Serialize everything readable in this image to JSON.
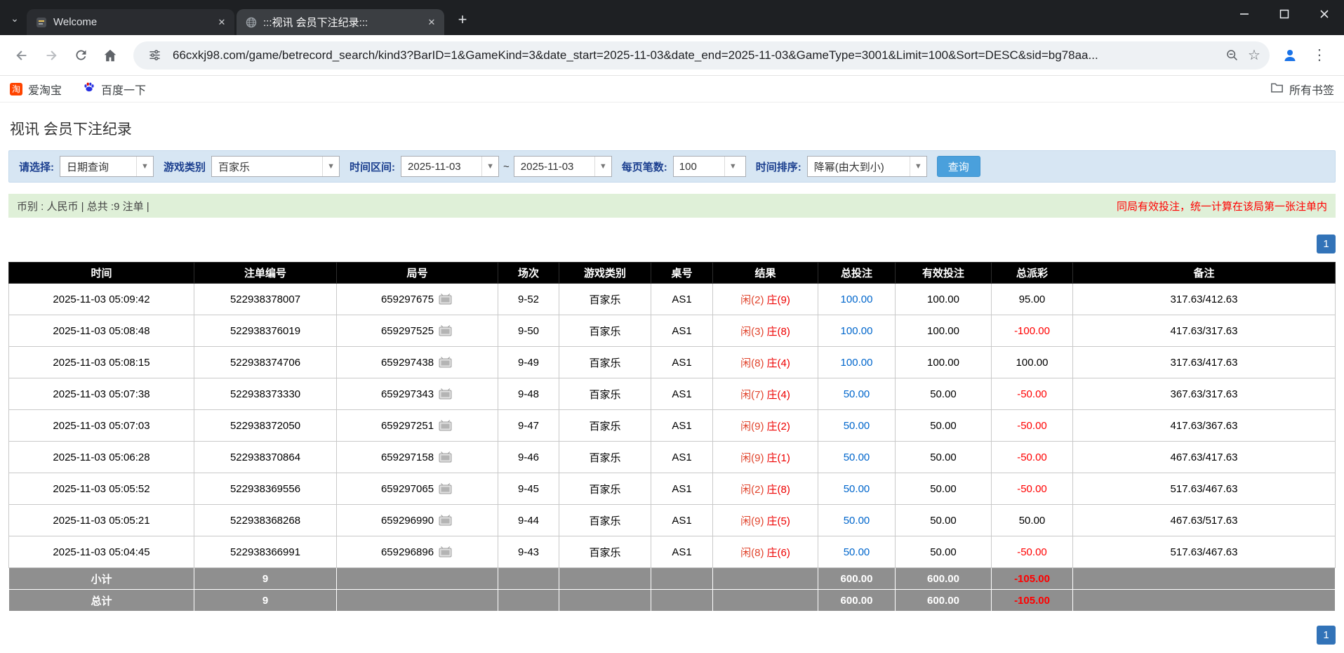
{
  "colors": {
    "accent_blue": "#3273b8",
    "link_blue": "#0066cc",
    "negative_red": "#ff0000",
    "player_color": "#e0442c",
    "banker_color": "#ee0000",
    "filter_bar_bg": "#d7e6f3",
    "summary_bar_bg": "#dff0d8",
    "table_header_bg": "#000000",
    "table_footer_bg": "#8f8f8f"
  },
  "browser": {
    "tabs": [
      {
        "title": "Welcome"
      },
      {
        "title": ":::视讯 会员下注纪录:::"
      }
    ],
    "url": "66cxkj98.com/game/betrecord_search/kind3?BarID=1&GameKind=3&date_start=2025-11-03&date_end=2025-11-03&GameType=3001&Limit=100&Sort=DESC&sid=bg78aa...",
    "bookmarks": [
      {
        "label": "爱淘宝"
      },
      {
        "label": "百度一下"
      }
    ],
    "all_bookmarks_label": "所有书签"
  },
  "page": {
    "title": "视讯 会员下注纪录",
    "filter": {
      "query_type_label": "请选择:",
      "query_type_value": "日期查询",
      "game_category_label": "游戏类别",
      "game_category_value": "百家乐",
      "date_range_label": "时间区间:",
      "date_start": "2025-11-03",
      "date_separator": "~",
      "date_end": "2025-11-03",
      "page_size_label": "每页笔数:",
      "page_size_value": "100",
      "sort_label": "时间排序:",
      "sort_value": "降幂(由大到小)",
      "search_button_label": "查询"
    },
    "summary": {
      "left_text": "币别 : 人民币 | 总共 :9 注单 |",
      "right_text": "同局有效投注，统一计算在该局第一张注单内"
    },
    "pagination": {
      "current_page": "1"
    },
    "table": {
      "headers": [
        "时间",
        "注单编号",
        "局号",
        "场次",
        "游戏类别",
        "桌号",
        "结果",
        "总投注",
        "有效投注",
        "总派彩",
        "备注"
      ],
      "rows": [
        {
          "time": "2025-11-03 05:09:42",
          "bet_id": "522938378007",
          "round_id": "659297675",
          "session": "9-52",
          "game": "百家乐",
          "table_no": "AS1",
          "result_player": "闲(2)",
          "result_banker": "庄(9)",
          "total_bet": "100.00",
          "valid_bet": "100.00",
          "payout": "95.00",
          "remark": "317.63/412.63"
        },
        {
          "time": "2025-11-03 05:08:48",
          "bet_id": "522938376019",
          "round_id": "659297525",
          "session": "9-50",
          "game": "百家乐",
          "table_no": "AS1",
          "result_player": "闲(3)",
          "result_banker": "庄(8)",
          "total_bet": "100.00",
          "valid_bet": "100.00",
          "payout": "-100.00",
          "remark": "417.63/317.63"
        },
        {
          "time": "2025-11-03 05:08:15",
          "bet_id": "522938374706",
          "round_id": "659297438",
          "session": "9-49",
          "game": "百家乐",
          "table_no": "AS1",
          "result_player": "闲(8)",
          "result_banker": "庄(4)",
          "total_bet": "100.00",
          "valid_bet": "100.00",
          "payout": "100.00",
          "remark": "317.63/417.63"
        },
        {
          "time": "2025-11-03 05:07:38",
          "bet_id": "522938373330",
          "round_id": "659297343",
          "session": "9-48",
          "game": "百家乐",
          "table_no": "AS1",
          "result_player": "闲(7)",
          "result_banker": "庄(4)",
          "total_bet": "50.00",
          "valid_bet": "50.00",
          "payout": "-50.00",
          "remark": "367.63/317.63"
        },
        {
          "time": "2025-11-03 05:07:03",
          "bet_id": "522938372050",
          "round_id": "659297251",
          "session": "9-47",
          "game": "百家乐",
          "table_no": "AS1",
          "result_player": "闲(9)",
          "result_banker": "庄(2)",
          "total_bet": "50.00",
          "valid_bet": "50.00",
          "payout": "-50.00",
          "remark": "417.63/367.63"
        },
        {
          "time": "2025-11-03 05:06:28",
          "bet_id": "522938370864",
          "round_id": "659297158",
          "session": "9-46",
          "game": "百家乐",
          "table_no": "AS1",
          "result_player": "闲(9)",
          "result_banker": "庄(1)",
          "total_bet": "50.00",
          "valid_bet": "50.00",
          "payout": "-50.00",
          "remark": "467.63/417.63"
        },
        {
          "time": "2025-11-03 05:05:52",
          "bet_id": "522938369556",
          "round_id": "659297065",
          "session": "9-45",
          "game": "百家乐",
          "table_no": "AS1",
          "result_player": "闲(2)",
          "result_banker": "庄(8)",
          "total_bet": "50.00",
          "valid_bet": "50.00",
          "payout": "-50.00",
          "remark": "517.63/467.63"
        },
        {
          "time": "2025-11-03 05:05:21",
          "bet_id": "522938368268",
          "round_id": "659296990",
          "session": "9-44",
          "game": "百家乐",
          "table_no": "AS1",
          "result_player": "闲(9)",
          "result_banker": "庄(5)",
          "total_bet": "50.00",
          "valid_bet": "50.00",
          "payout": "50.00",
          "remark": "467.63/517.63"
        },
        {
          "time": "2025-11-03 05:04:45",
          "bet_id": "522938366991",
          "round_id": "659296896",
          "session": "9-43",
          "game": "百家乐",
          "table_no": "AS1",
          "result_player": "闲(8)",
          "result_banker": "庄(6)",
          "total_bet": "50.00",
          "valid_bet": "50.00",
          "payout": "-50.00",
          "remark": "517.63/467.63"
        }
      ],
      "subtotal": {
        "label": "小计",
        "count": "9",
        "total_bet": "600.00",
        "valid_bet": "600.00",
        "payout": "-105.00",
        "remark": ""
      },
      "total": {
        "label": "总计",
        "count": "9",
        "total_bet": "600.00",
        "valid_bet": "600.00",
        "payout": "-105.00",
        "remark": ""
      }
    }
  }
}
